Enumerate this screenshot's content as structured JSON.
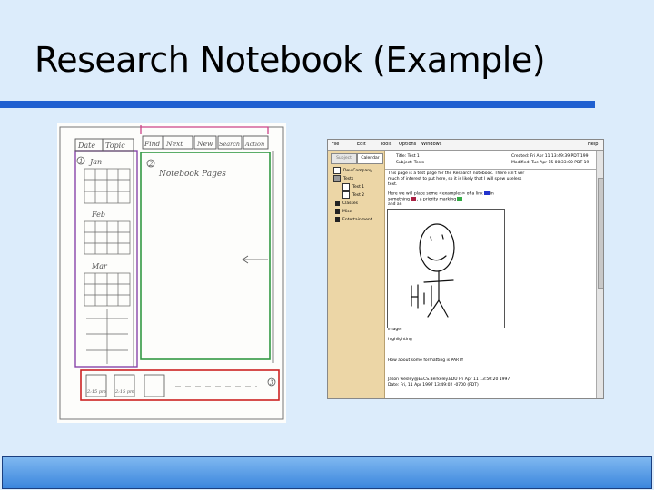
{
  "slide": {
    "title": "Research Notebook (Example)"
  },
  "colors": {
    "title_rule": "#2060d0",
    "footer": "#3b86dd",
    "sidebar": "#ecd6a6"
  },
  "sketch": {
    "tabs": [
      "Date",
      "Topic"
    ],
    "toolbar": [
      "Find",
      "Next",
      "New",
      "Search",
      "Action"
    ],
    "months": [
      "Jan",
      "Feb",
      "Mar"
    ],
    "page_label": "Notebook Pages",
    "markers": [
      "1",
      "2",
      "3"
    ],
    "thumb_labels": [
      "2:15 pm",
      "2:15 pm"
    ]
  },
  "app": {
    "menu": [
      "File",
      "Edit",
      "Tools",
      "Options",
      "Windows",
      "Help"
    ],
    "tabs": [
      "Subject",
      "Calendar"
    ],
    "tree": [
      {
        "label": "Dev Company",
        "icon": "page-icon",
        "indent": 0
      },
      {
        "label": "Tests",
        "icon": "notebook-icon",
        "indent": 0
      },
      {
        "label": "Test 1",
        "icon": "page-icon",
        "indent": 1
      },
      {
        "label": "Test 2",
        "icon": "page-icon",
        "indent": 1
      },
      {
        "label": "Classes",
        "icon": "book-icon",
        "indent": 0
      },
      {
        "label": "Misc",
        "icon": "book-icon",
        "indent": 0
      },
      {
        "label": "Entertainment",
        "icon": "book-icon",
        "indent": 0
      }
    ],
    "header": {
      "title": "Title: Test 1",
      "subject": "Subject: Tests",
      "created": "Created: Fri Apr 11 13:49:39 PDT 199",
      "modified": "Modified: Tue Apr 15 00:33:00 PDT 19"
    },
    "body": {
      "line1": "This page is a test page for the Research notebook. There isn't ver",
      "line2": "much of interest to put here, so it is likely that I will spew useless",
      "line3": "text.",
      "line4a": "Here we will place some <examples> of a link",
      "line4b": "in",
      "line5a": "something",
      "line5b": ", a priority marking",
      "line6": "and an",
      "image_label": "image!",
      "highlight_label": "highlighting",
      "line7": "How about some formatting is PARTY",
      "sig1": "Jason wesley@EECS.Berkeley.EDU Fri Apr 11 13:50:20 1997",
      "sig2": "Date: Fri, 11 Apr 1997 13:49:02 -0700 (PDT)"
    }
  }
}
